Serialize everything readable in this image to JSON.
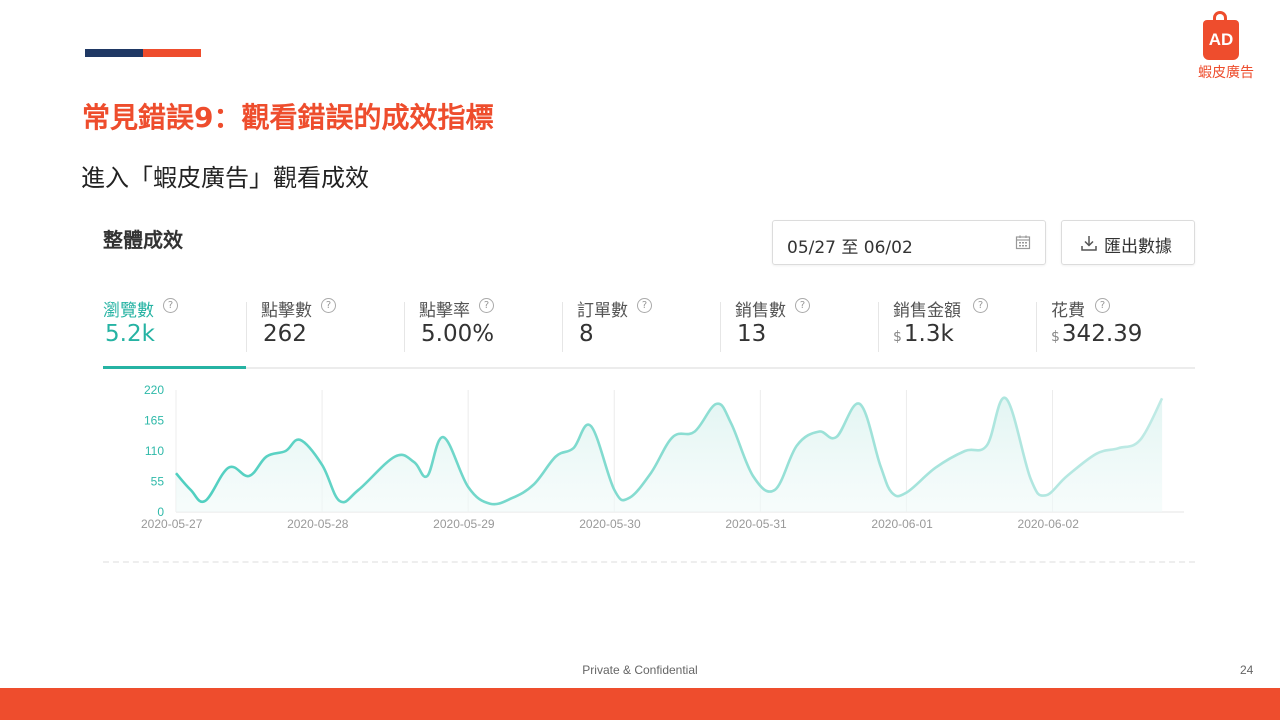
{
  "slide": {
    "title": "常見錯誤9：觀看錯誤的成效指標",
    "subtitle": "進入「蝦皮廣告」觀看成效",
    "brand_badge": "AD",
    "brand_name": "蝦皮廣告",
    "footer": "Private & Confidential",
    "page_number": "24",
    "colors": {
      "brand": "#ee4d2d",
      "navy": "#1f3864",
      "teal": "#26b3a3"
    }
  },
  "panel": {
    "title": "整體成效",
    "date_range": "05/27 至 06/02",
    "export_label": "匯出數據",
    "icons": {
      "date": "calendar-icon",
      "export": "download-icon",
      "help": "help-circle-icon"
    },
    "metrics": [
      {
        "label": "瀏覽數",
        "value": "5.2k",
        "currency": "",
        "active": true
      },
      {
        "label": "點擊數",
        "value": "262",
        "currency": ""
      },
      {
        "label": "點擊率",
        "value": "5.00%",
        "currency": ""
      },
      {
        "label": "訂單數",
        "value": "8",
        "currency": ""
      },
      {
        "label": "銷售數",
        "value": "13",
        "currency": ""
      },
      {
        "label": "銷售金額",
        "value": "1.3k",
        "currency": "$"
      },
      {
        "label": "花費",
        "value": "342.39",
        "currency": "$"
      }
    ]
  },
  "chart_data": {
    "type": "line",
    "series": [
      {
        "values": [
          [
            0,
            70
          ],
          [
            0.1,
            40
          ],
          [
            0.2,
            20
          ],
          [
            0.36,
            80
          ],
          [
            0.5,
            65
          ],
          [
            0.62,
            100
          ],
          [
            0.75,
            110
          ],
          [
            0.85,
            130
          ],
          [
            1.0,
            85
          ],
          [
            1.12,
            20
          ],
          [
            1.25,
            40
          ],
          [
            1.5,
            100
          ],
          [
            1.63,
            90
          ],
          [
            1.72,
            65
          ],
          [
            1.83,
            135
          ],
          [
            2.0,
            45
          ],
          [
            2.15,
            15
          ],
          [
            2.3,
            25
          ],
          [
            2.45,
            50
          ],
          [
            2.6,
            100
          ],
          [
            2.72,
            115
          ],
          [
            2.84,
            155
          ],
          [
            3.0,
            40
          ],
          [
            3.1,
            25
          ],
          [
            3.25,
            70
          ],
          [
            3.4,
            135
          ],
          [
            3.55,
            145
          ],
          [
            3.7,
            195
          ],
          [
            3.8,
            160
          ],
          [
            3.95,
            65
          ],
          [
            4.1,
            40
          ],
          [
            4.25,
            120
          ],
          [
            4.4,
            145
          ],
          [
            4.52,
            135
          ],
          [
            4.68,
            195
          ],
          [
            4.82,
            85
          ],
          [
            4.9,
            35
          ],
          [
            5.0,
            35
          ],
          [
            5.2,
            80
          ],
          [
            5.4,
            110
          ],
          [
            5.55,
            120
          ],
          [
            5.68,
            205
          ],
          [
            5.85,
            60
          ],
          [
            5.95,
            30
          ],
          [
            6.1,
            65
          ],
          [
            6.3,
            105
          ],
          [
            6.45,
            115
          ],
          [
            6.6,
            130
          ],
          [
            6.75,
            205
          ]
        ]
      }
    ],
    "x_tick_labels": [
      "2020-05-27",
      "2020-05-28",
      "2020-05-29",
      "2020-05-30",
      "2020-05-31",
      "2020-06-01",
      "2020-06-02"
    ],
    "x_range": [
      0,
      6.9
    ],
    "y_ticks": [
      "0",
      "55",
      "110",
      "165",
      "220"
    ],
    "ylim": [
      0,
      220
    ],
    "grid": true,
    "colors": {
      "early_line": "#4fcfc0",
      "late_line": "#bfeae5",
      "axis_text": "#2fb9a9",
      "x_text": "#999999"
    }
  }
}
